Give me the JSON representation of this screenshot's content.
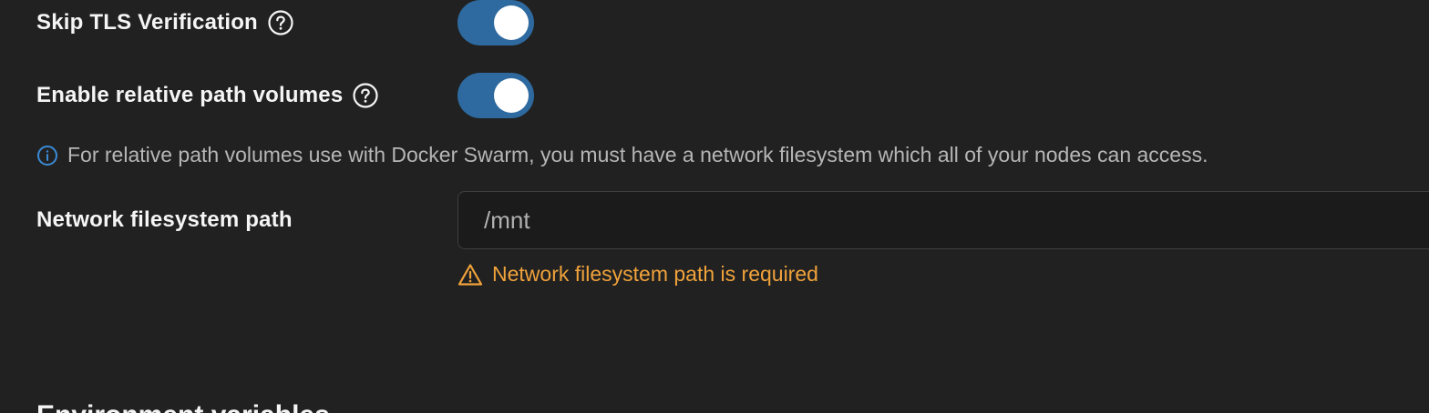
{
  "settings": {
    "skip_tls": {
      "label": "Skip TLS Verification",
      "enabled": true
    },
    "relative_paths": {
      "label": "Enable relative path volumes",
      "enabled": true
    }
  },
  "info": {
    "message": "For relative path volumes use with Docker Swarm, you must have a network filesystem which all of your nodes can access."
  },
  "network_fs": {
    "label": "Network filesystem path",
    "value": "/mnt",
    "error": "Network filesystem path is required"
  },
  "next_section": {
    "heading": "Environment variables"
  },
  "colors": {
    "background": "#212121",
    "toggle_on": "#2e6a9f",
    "info_icon": "#3a8ad6",
    "warning": "#f0a23b"
  },
  "icons": {
    "help": "question-circle-icon",
    "info": "info-circle-icon",
    "warning": "warning-triangle-icon"
  }
}
